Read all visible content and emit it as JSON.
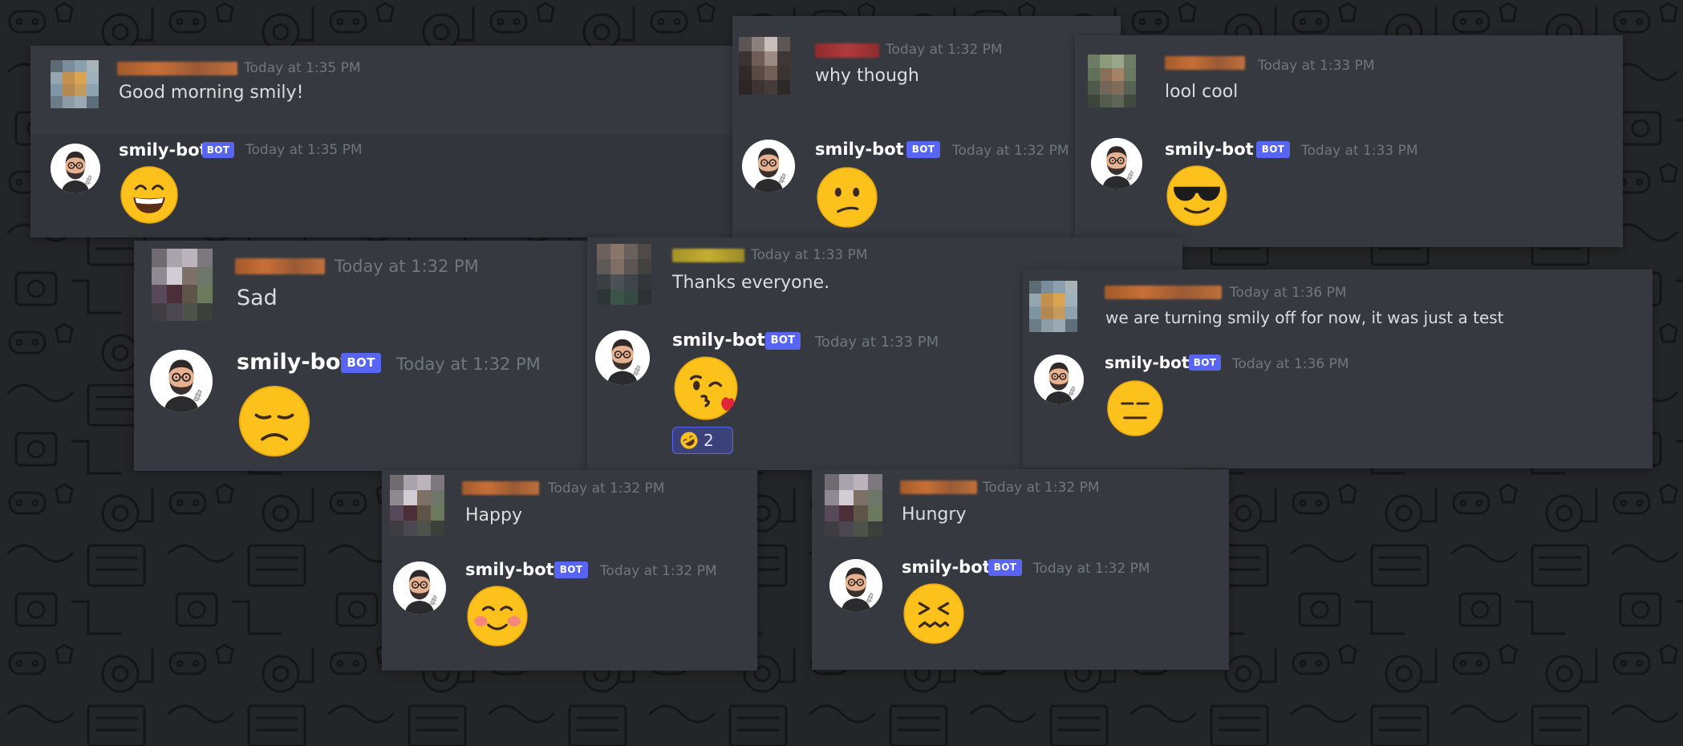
{
  "bot": {
    "name": "smily-bot",
    "badge": "BOT"
  },
  "panels": [
    {
      "user_text": "Good morning smily!",
      "user_time": "Today at 1:35 PM",
      "bot_time": "Today at 1:35 PM",
      "emoji": "grinning-smiling-eyes-emoji"
    },
    {
      "user_text": "why though",
      "user_time": "Today at 1:32 PM",
      "bot_time": "Today at 1:32 PM",
      "emoji": "confused-face-emoji"
    },
    {
      "user_text": "lool cool",
      "user_time": "Today at 1:33 PM",
      "bot_time": "Today at 1:33 PM",
      "emoji": "sunglasses-face-emoji"
    },
    {
      "user_text": "Sad",
      "user_time": "Today at 1:32 PM",
      "bot_time": "Today at 1:32 PM",
      "emoji": "disappointed-face-emoji"
    },
    {
      "user_text": "Thanks everyone.",
      "user_time": "Today at 1:33 PM",
      "bot_time": "Today at 1:33 PM",
      "emoji": "kissing-heart-emoji",
      "reaction": {
        "emoji": "rolling-laughing-emoji",
        "count": "2"
      }
    },
    {
      "user_text": "we are turning smily off for now, it was just a test",
      "user_time": "Today at 1:36 PM",
      "bot_time": "Today at 1:36 PM",
      "emoji": "expressionless-face-emoji"
    },
    {
      "user_text": "Happy",
      "user_time": "Today at 1:32 PM",
      "bot_time": "Today at 1:32 PM",
      "emoji": "blushing-face-emoji"
    },
    {
      "user_text": "Hungry",
      "user_time": "Today at 1:32 PM",
      "bot_time": "Today at 1:32 PM",
      "emoji": "confounded-face-emoji"
    }
  ],
  "colors": {
    "card": "#36393f",
    "background": "#242528",
    "badge": "#5865f2",
    "timestamp": "#72767d",
    "emoji_yellow": "#fcc21b"
  }
}
